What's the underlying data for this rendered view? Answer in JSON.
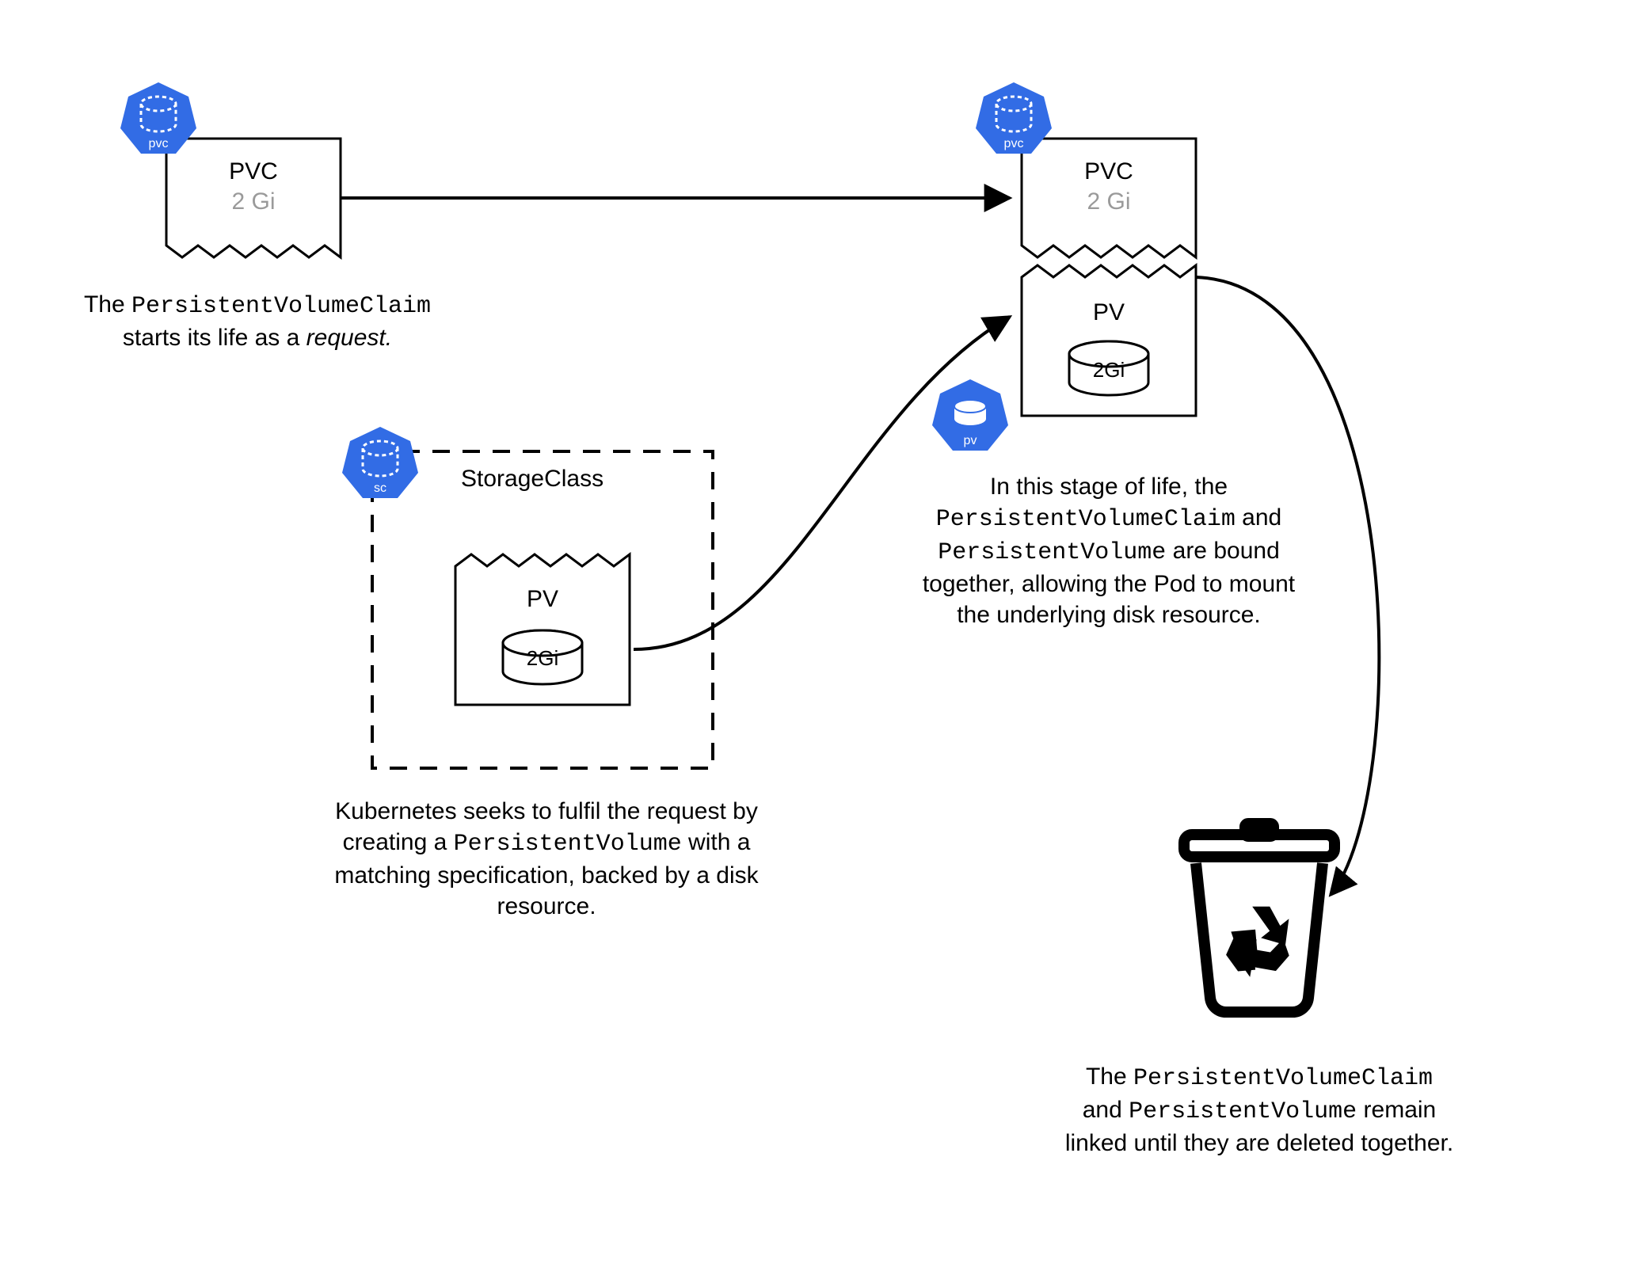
{
  "accent_color": "#326CE5",
  "icons": {
    "pvc1_label": "pvc",
    "pvc2_label": "pvc",
    "pv_label": "pv",
    "sc_label": "sc"
  },
  "nodes": {
    "pvc1": {
      "title": "PVC",
      "size": "2 Gi"
    },
    "pvc2": {
      "title": "PVC",
      "size": "2 Gi"
    },
    "pv_sc": {
      "title": "PV",
      "size": "2Gi"
    },
    "pv_bound": {
      "title": "PV",
      "size": "2Gi"
    },
    "storage_class_title": "StorageClass"
  },
  "captions": {
    "c1_pre": "The ",
    "c1_code": "PersistentVolumeClaim",
    "c1_post_line2_a": "starts its life as a ",
    "c1_post_line2_b": "request.",
    "c2_line1": "Kubernetes seeks to fulfil the request by",
    "c2_line2_a": "creating a ",
    "c2_line2_b": "PersistentVolume",
    "c2_line2_c": " with a",
    "c2_line3": "matching specification, backed by a disk",
    "c2_line4": "resource.",
    "c3_line1": "In this stage of life, the",
    "c3_line2_a": "PersistentVolumeClaim",
    "c3_line2_b": " and",
    "c3_line3_a": "PersistentVolume",
    "c3_line3_b": " are bound",
    "c3_line4": "together, allowing the Pod to mount",
    "c3_line5": "the underlying disk resource.",
    "c4_line1_a": "The ",
    "c4_line1_b": "PersistentVolumeClaim",
    "c4_line2_a": "and ",
    "c4_line2_b": "PersistentVolume",
    "c4_line2_c": " remain",
    "c4_line3": "linked until they are deleted together."
  }
}
